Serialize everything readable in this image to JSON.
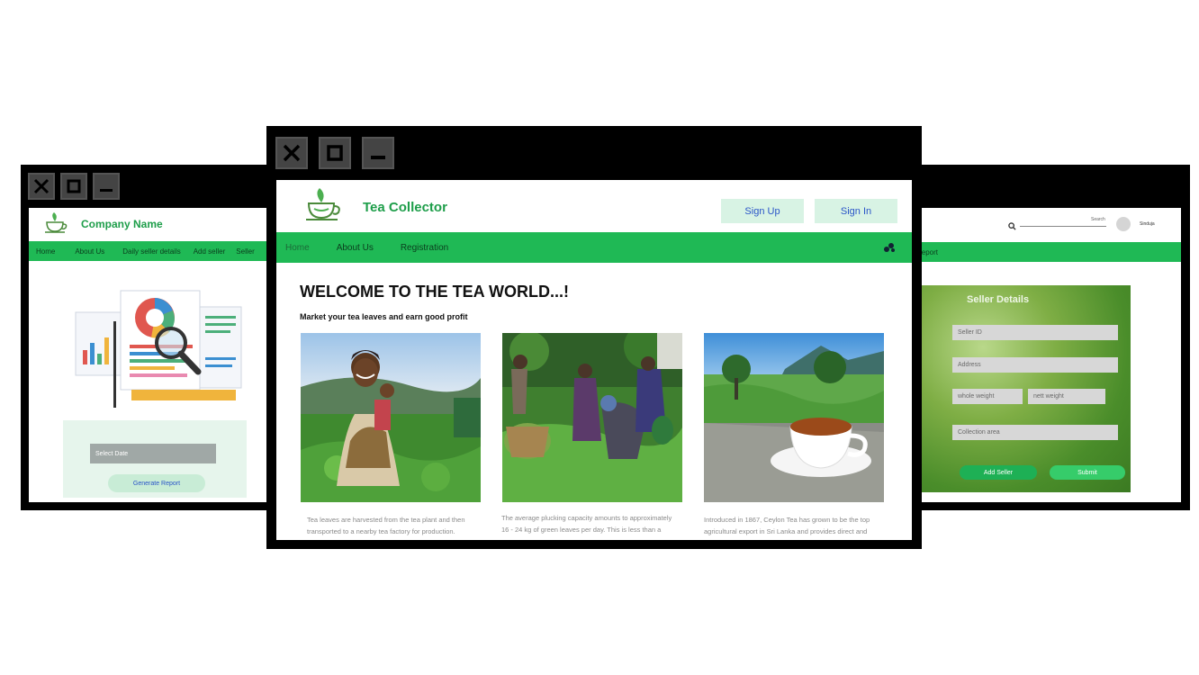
{
  "left_window": {
    "company_name": "Company Name",
    "nav": [
      "Home",
      "About Us",
      "Daily seller details",
      "Add seller",
      "Seller"
    ],
    "select_date_placeholder": "Select Date",
    "generate_report_label": "Generate Report"
  },
  "center_window": {
    "brand": "Tea Collector",
    "sign_up_label": "Sign Up",
    "sign_in_label": "Sign In",
    "nav": [
      "Home",
      "About Us",
      "Registration"
    ],
    "welcome_title": "WELCOME TO THE TEA WORLD...!",
    "subtitle": "Market your tea leaves and earn good profit",
    "cards": [
      {
        "text1": "Tea leaves are harvested from the tea plant and then",
        "text2": "transported to a nearby tea factory for production."
      },
      {
        "text1": "The average plucking capacity amounts to approximately",
        "text2": "16 - 24 kg of green leaves per day. This is less than a"
      },
      {
        "text1": "Introduced in 1867, Ceylon Tea has grown to be the top",
        "text2": "agricultural export in Sri Lanka and provides direct and"
      }
    ]
  },
  "right_window": {
    "search_label": "Search",
    "user_label": "Sinduja",
    "nav_fragment": "Report",
    "form_title": "Seller Details",
    "fields": {
      "seller_id": "Seller ID",
      "address": "Address",
      "whole_weight": "whole weight",
      "net_weight": "nett weight",
      "collection_area": "Collection area"
    },
    "add_seller_label": "Add Seller",
    "submit_label": "Submit"
  },
  "colors": {
    "nav_green": "#1fb955",
    "brand_green": "#1e9e4a",
    "button_bg": "#d8f3e4",
    "button_text": "#2a55c8",
    "window_frame": "#000000"
  }
}
